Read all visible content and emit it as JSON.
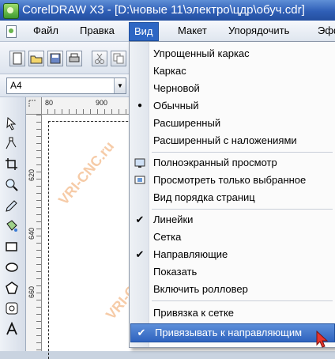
{
  "window": {
    "title": "CorelDRAW X3 - [D:\\новые 11\\электро\\цдр\\обуч.cdr]"
  },
  "menubar": {
    "items": [
      "Файл",
      "Правка",
      "Вид",
      "Макет",
      "Упорядочить",
      "Эфф"
    ],
    "active_index": 2
  },
  "propbar": {
    "page_size": "A4"
  },
  "rulers": {
    "horizontal_labels": [
      "80",
      "900"
    ],
    "vertical_labels": [
      "620",
      "640",
      "660"
    ]
  },
  "view_menu": {
    "items": [
      {
        "label": "Упрощенный каркас",
        "check": "",
        "icon": ""
      },
      {
        "label": "Каркас",
        "check": "",
        "icon": ""
      },
      {
        "label": "Черновой",
        "check": "",
        "icon": ""
      },
      {
        "label": "Обычный",
        "check": "●",
        "icon": ""
      },
      {
        "label": "Расширенный",
        "check": "",
        "icon": ""
      },
      {
        "label": "Расширенный с наложениями",
        "check": "",
        "icon": ""
      },
      {
        "label": "Полноэкранный просмотр",
        "check": "",
        "icon": "fullscreen-icon"
      },
      {
        "label": "Просмотреть только выбранное",
        "check": "",
        "icon": "view-selected-icon"
      },
      {
        "label": "Вид порядка страниц",
        "check": "",
        "icon": "page-sorter-icon"
      },
      {
        "label": "Линейки",
        "check": "✔",
        "icon": ""
      },
      {
        "label": "Сетка",
        "check": "",
        "icon": ""
      },
      {
        "label": "Направляющие",
        "check": "✔",
        "icon": ""
      },
      {
        "label": "Показать",
        "check": "",
        "icon": ""
      },
      {
        "label": "Включить ролловер",
        "check": "",
        "icon": ""
      },
      {
        "label": "Привязка к сетке",
        "check": "",
        "icon": ""
      },
      {
        "label": "Привязывать к направляющим",
        "check": "✔",
        "icon": ""
      }
    ],
    "hover_index": 15
  },
  "watermark": {
    "text": "VRI-CNC.ru"
  },
  "colors": {
    "menu_highlight": "#2d66c4",
    "watermark": "#ea8c3c"
  }
}
